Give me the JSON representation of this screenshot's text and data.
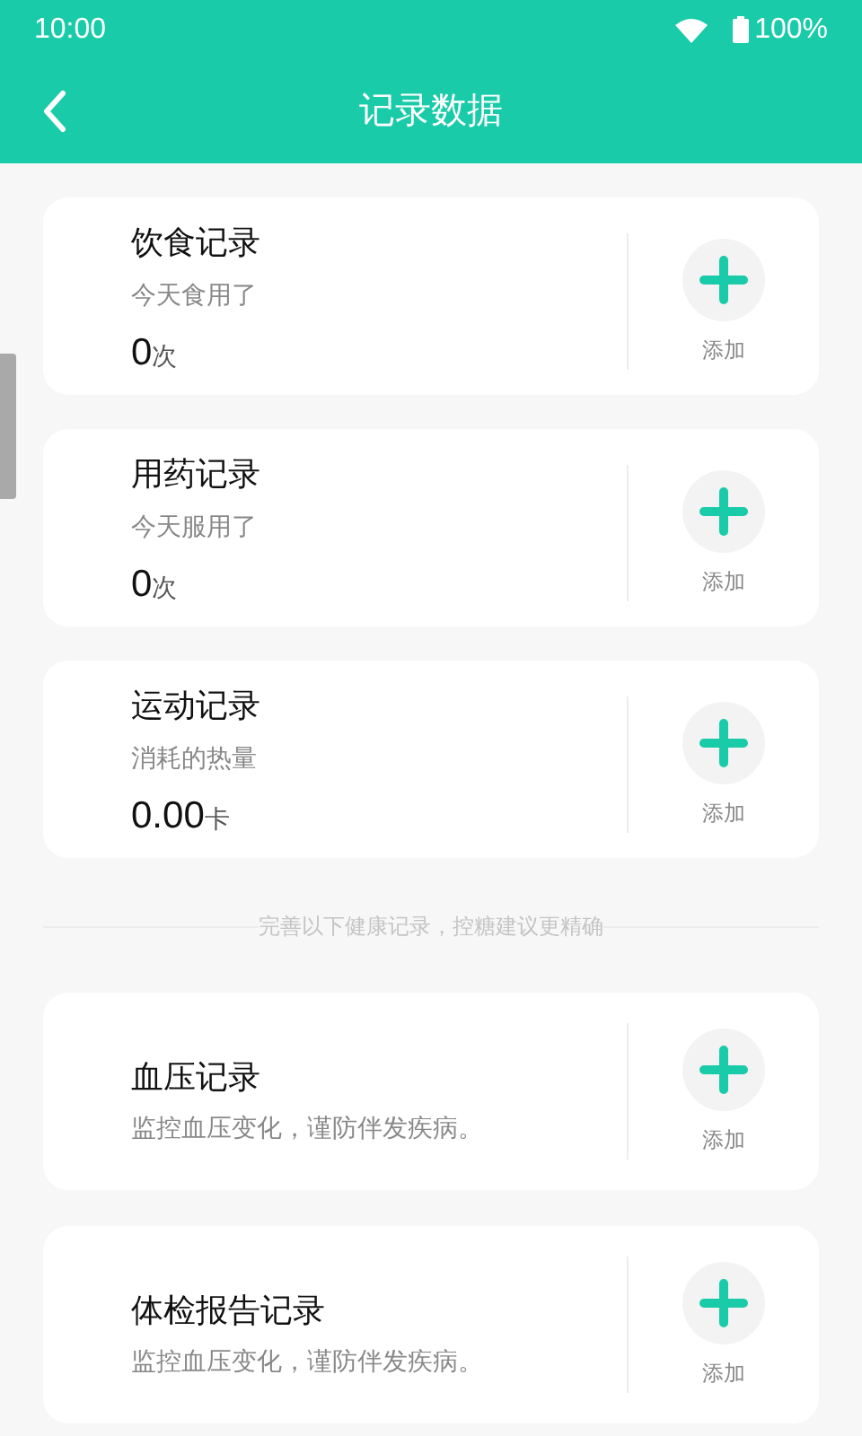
{
  "status_bar": {
    "time": "10:00",
    "battery": "100%"
  },
  "header": {
    "title": "记录数据"
  },
  "records": [
    {
      "kind": "count",
      "title": "饮食记录",
      "subtitle": "今天食用了",
      "value": "0",
      "unit": "次",
      "action": "添加"
    },
    {
      "kind": "count",
      "title": "用药记录",
      "subtitle": "今天服用了",
      "value": "0",
      "unit": "次",
      "action": "添加"
    },
    {
      "kind": "count",
      "title": "运动记录",
      "subtitle": "消耗的热量",
      "value": "0.00",
      "unit": "卡",
      "action": "添加"
    }
  ],
  "section_divider": "完善以下健康记录，控糖建议更精确",
  "health_records": [
    {
      "kind": "info",
      "title": "血压记录",
      "subtitle": "监控血压变化，谨防伴发疾病。",
      "action": "添加"
    },
    {
      "kind": "info",
      "title": "体检报告记录",
      "subtitle": "监控血压变化，谨防伴发疾病。",
      "action": "添加"
    }
  ]
}
